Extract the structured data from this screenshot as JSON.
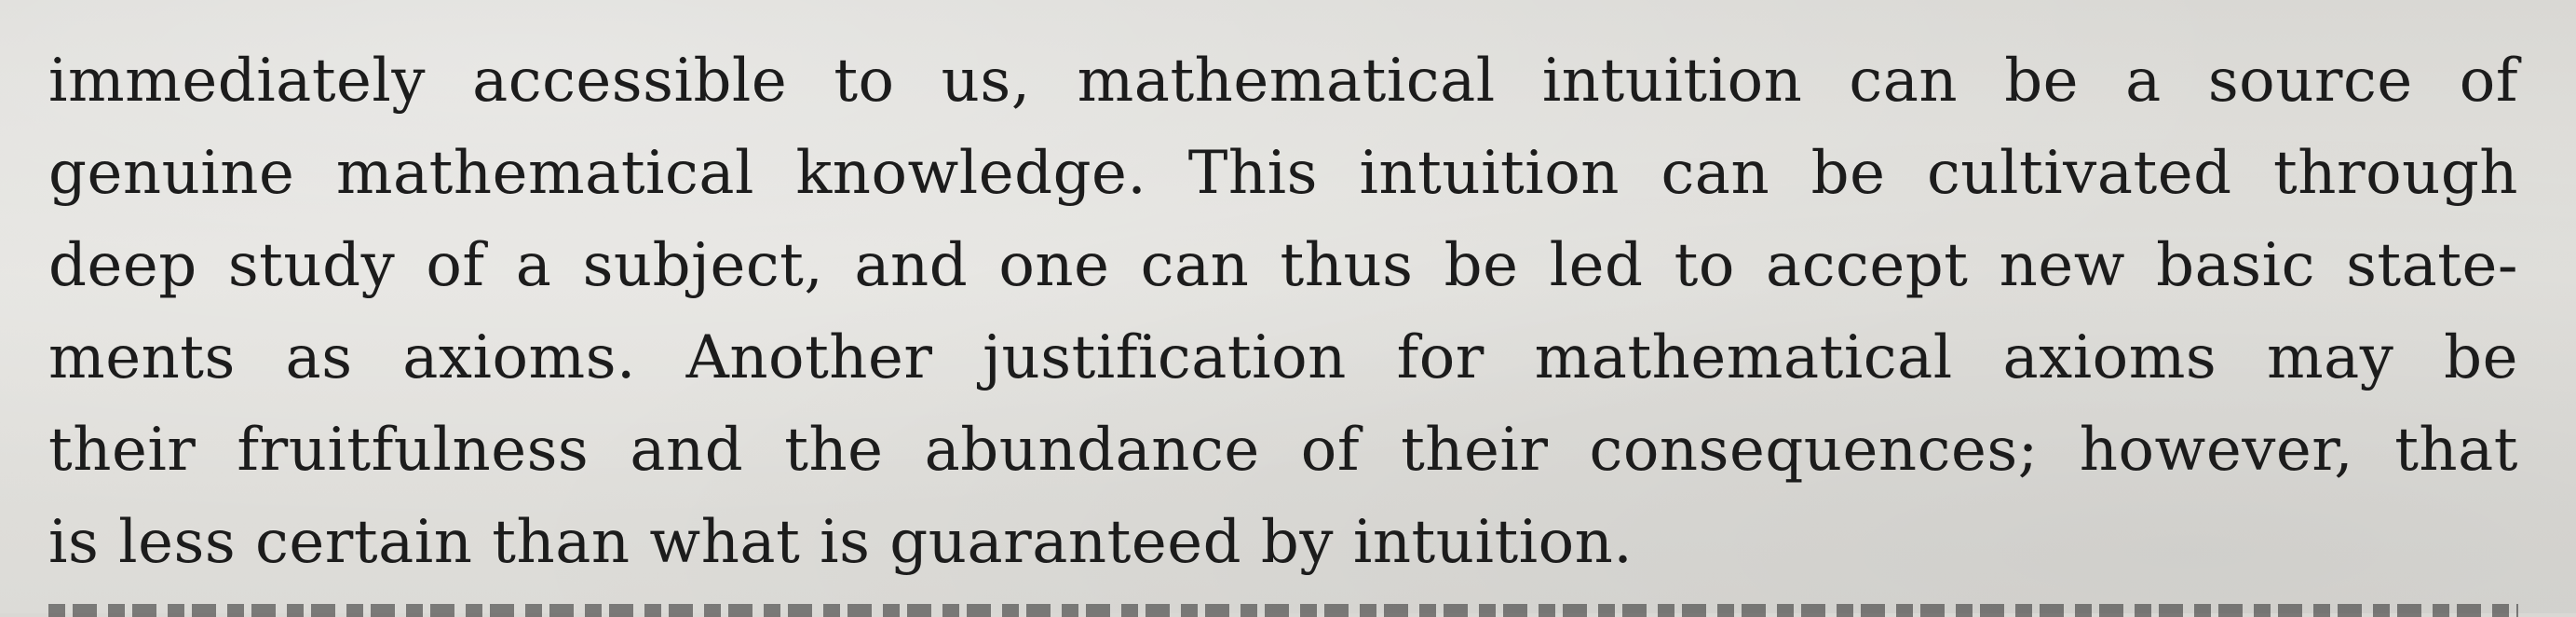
{
  "paragraph": {
    "lines": [
      "immediately accessible to us, mathematical intuition can be a source of",
      "genuine mathematical knowledge. This intuition can be cultivated through",
      "deep study of a subject, and one can thus be led to accept new basic state-",
      "ments as axioms. Another justification for mathematical axioms may be",
      "their fruitfulness and the abundance of their consequences; however, that",
      "is less certain than what is guaranteed by intuition."
    ]
  }
}
